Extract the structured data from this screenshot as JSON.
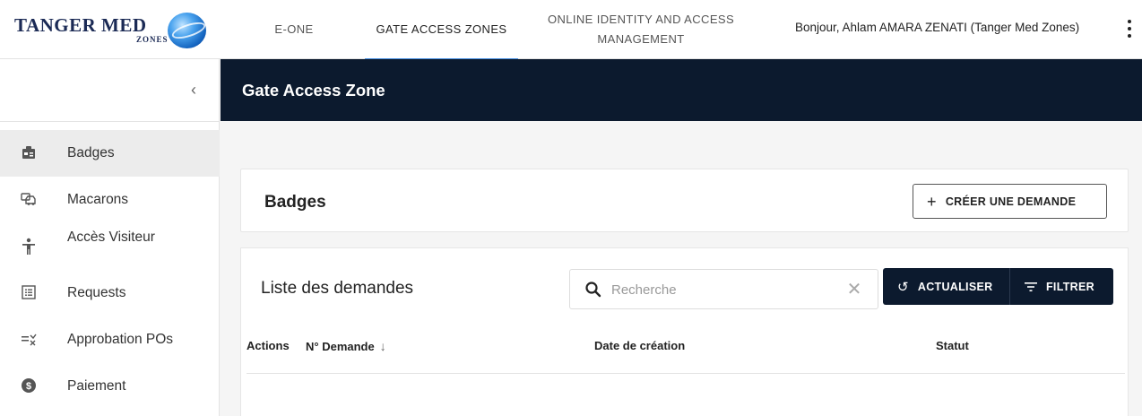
{
  "logo": {
    "brand": "TANGER MED",
    "sub": "ZONES"
  },
  "nav": {
    "tabs": [
      {
        "label": "E-ONE"
      },
      {
        "label": "GATE ACCESS ZONES"
      },
      {
        "label_line1": "ONLINE IDENTITY AND ACCESS",
        "label_line2": "MANAGEMENT"
      }
    ],
    "greeting": "Bonjour, Ahlam AMARA ZENATI (Tanger Med Zones)"
  },
  "sidebar": {
    "collapse_icon": "chevron-left-icon",
    "items": [
      {
        "label": "Badges",
        "icon": "badge-icon"
      },
      {
        "label": "Macarons",
        "icon": "vehicle-icon"
      },
      {
        "label": "Accès Visiteur",
        "icon": "person-icon"
      },
      {
        "label": "Requests",
        "icon": "list-icon"
      },
      {
        "label": "Approbation POs",
        "icon": "approval-icon"
      },
      {
        "label": "Paiement",
        "icon": "dollar-icon"
      }
    ]
  },
  "header": {
    "title": "Gate Access Zone"
  },
  "badges_card": {
    "title": "Badges",
    "create_button": "CRÉER UNE DEMANDE"
  },
  "list": {
    "title": "Liste des demandes",
    "search_placeholder": "Recherche",
    "refresh_button": "ACTUALISER",
    "filter_button": "FILTRER",
    "columns": {
      "actions": "Actions",
      "number": "N° Demande",
      "date": "Date de création",
      "status": "Statut"
    }
  },
  "colors": {
    "header_bg": "#0c1a2e",
    "active_tab_underline": "#4a90e2",
    "sidebar_active": "#ececec"
  }
}
